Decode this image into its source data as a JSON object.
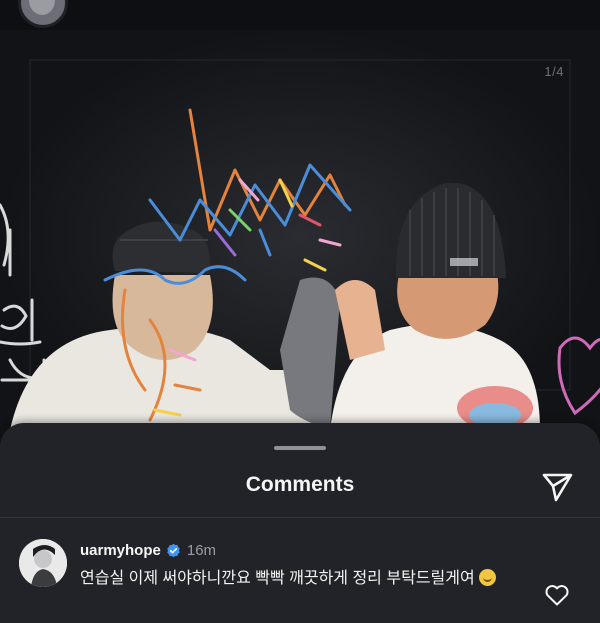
{
  "post": {
    "page_counter": "1/4"
  },
  "comments_sheet": {
    "title": "Comments",
    "send_icon": "paper-plane-icon",
    "comments": [
      {
        "username": "uarmyhope",
        "verified": true,
        "time": "16m",
        "text": "연습실 이제 써야하니깐요 빡빡 깨끗하게 정리 부탁드릴게여",
        "emoji": "grinning-face",
        "like_icon": "heart-outline-icon"
      }
    ]
  },
  "colors": {
    "background": "#0b0d10",
    "sheet": "#212328",
    "verified": "#3b96f5"
  }
}
